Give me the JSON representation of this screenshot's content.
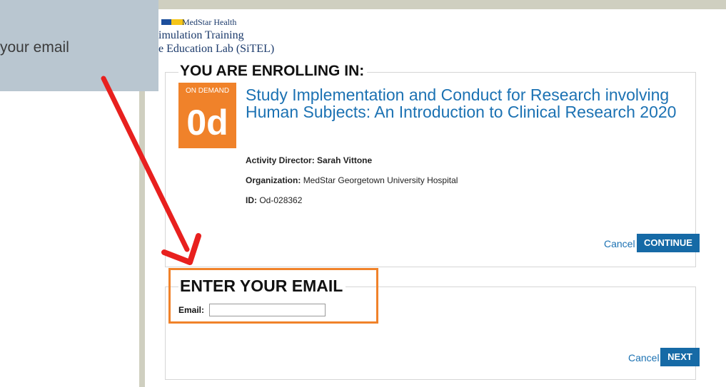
{
  "callout": {
    "text": "your email"
  },
  "logo": {
    "line1": "MedStar Health",
    "line2": "imulation Training",
    "line3": "e Education Lab (SiTEL)"
  },
  "enroll": {
    "heading": "YOU ARE ENROLLING IN:",
    "badge": {
      "label": "ON DEMAND",
      "code": "0d"
    },
    "course_title": "Study Implementation and Conduct for Research involving Human Subjects: An Introduction to Clinical Research 2020",
    "director_label": "Activity Director:",
    "director_value": "Sarah Vittone",
    "organization_label": "Organization:",
    "organization_value": "MedStar Georgetown University Hospital",
    "id_label": "ID:",
    "id_value": "Od-028362",
    "cancel_label": "Cancel",
    "continue_label": "CONTINUE"
  },
  "email_section": {
    "heading": "ENTER YOUR EMAIL",
    "email_label": "Email:",
    "email_value": "",
    "cancel_label": "Cancel",
    "next_label": "NEXT"
  },
  "colors": {
    "accent_blue": "#166aa6",
    "link_blue": "#1c72b3",
    "badge_orange": "#f0822a",
    "arrow_red": "#e8201e",
    "callout_bg": "#b9c6d0"
  }
}
